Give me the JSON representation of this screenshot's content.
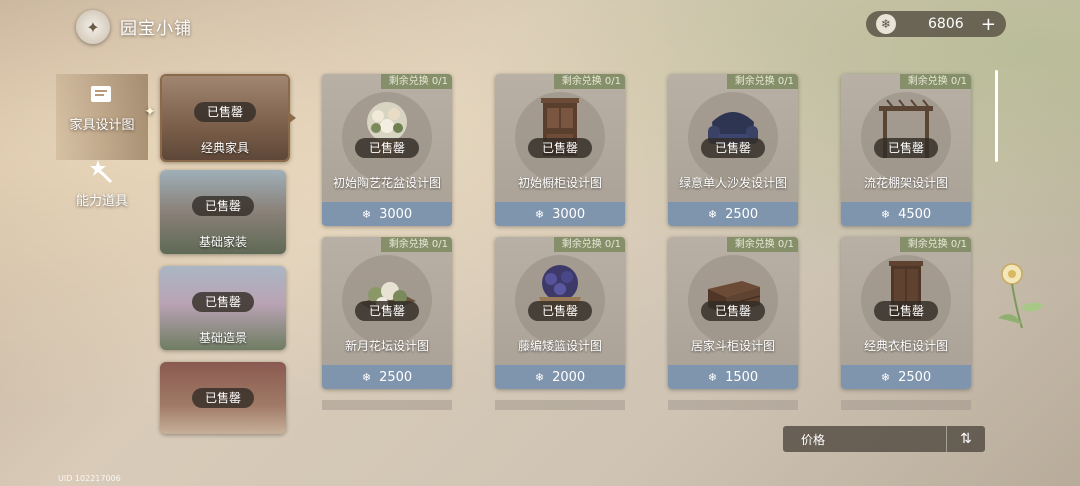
{
  "header": {
    "title": "园宝小铺",
    "back_icon": "compass-back-icon"
  },
  "currency": {
    "icon": "snowflake-coin-icon",
    "amount": "6806",
    "add_label": "+"
  },
  "nav": [
    {
      "label": "家具设计图",
      "icon": "blueprint-scroll-icon",
      "active": true
    },
    {
      "label": "能力道具",
      "icon": "magic-wand-icon",
      "active": false
    }
  ],
  "categories": [
    {
      "label": "经典家具",
      "sold": "已售罄",
      "active": true
    },
    {
      "label": "基础家装",
      "sold": "已售罄",
      "active": false
    },
    {
      "label": "基础造景",
      "sold": "已售罄",
      "active": false
    },
    {
      "label": "",
      "sold": "已售罄",
      "active": false
    }
  ],
  "items": [
    {
      "title": "初始陶艺花盆设计图",
      "price": "3000",
      "remain": "剩余兑换 0/1",
      "sold": "已售罄",
      "icon": "flower-pot-icon"
    },
    {
      "title": "初始橱柜设计图",
      "price": "3000",
      "remain": "剩余兑换 0/1",
      "sold": "已售罄",
      "icon": "cupboard-icon"
    },
    {
      "title": "绿意单人沙发设计图",
      "price": "2500",
      "remain": "剩余兑换 0/1",
      "sold": "已售罄",
      "icon": "armchair-icon"
    },
    {
      "title": "流花棚架设计图",
      "price": "4500",
      "remain": "剩余兑换 0/1",
      "sold": "已售罄",
      "icon": "pergola-icon"
    },
    {
      "title": "新月花坛设计图",
      "price": "2500",
      "remain": "剩余兑换 0/1",
      "sold": "已售罄",
      "icon": "flower-bed-icon"
    },
    {
      "title": "藤编矮篮设计图",
      "price": "2000",
      "remain": "剩余兑换 0/1",
      "sold": "已售罄",
      "icon": "wicker-basket-icon"
    },
    {
      "title": "居家斗柜设计图",
      "price": "1500",
      "remain": "剩余兑换 0/1",
      "sold": "已售罄",
      "icon": "chest-of-drawers-icon"
    },
    {
      "title": "经典衣柜设计图",
      "price": "2500",
      "remain": "剩余兑换 0/1",
      "sold": "已售罄",
      "icon": "wardrobe-icon"
    }
  ],
  "sort": {
    "label": "价格",
    "icon": "sort-toggle-icon"
  },
  "footer": {
    "uid": "UID 102217006"
  }
}
